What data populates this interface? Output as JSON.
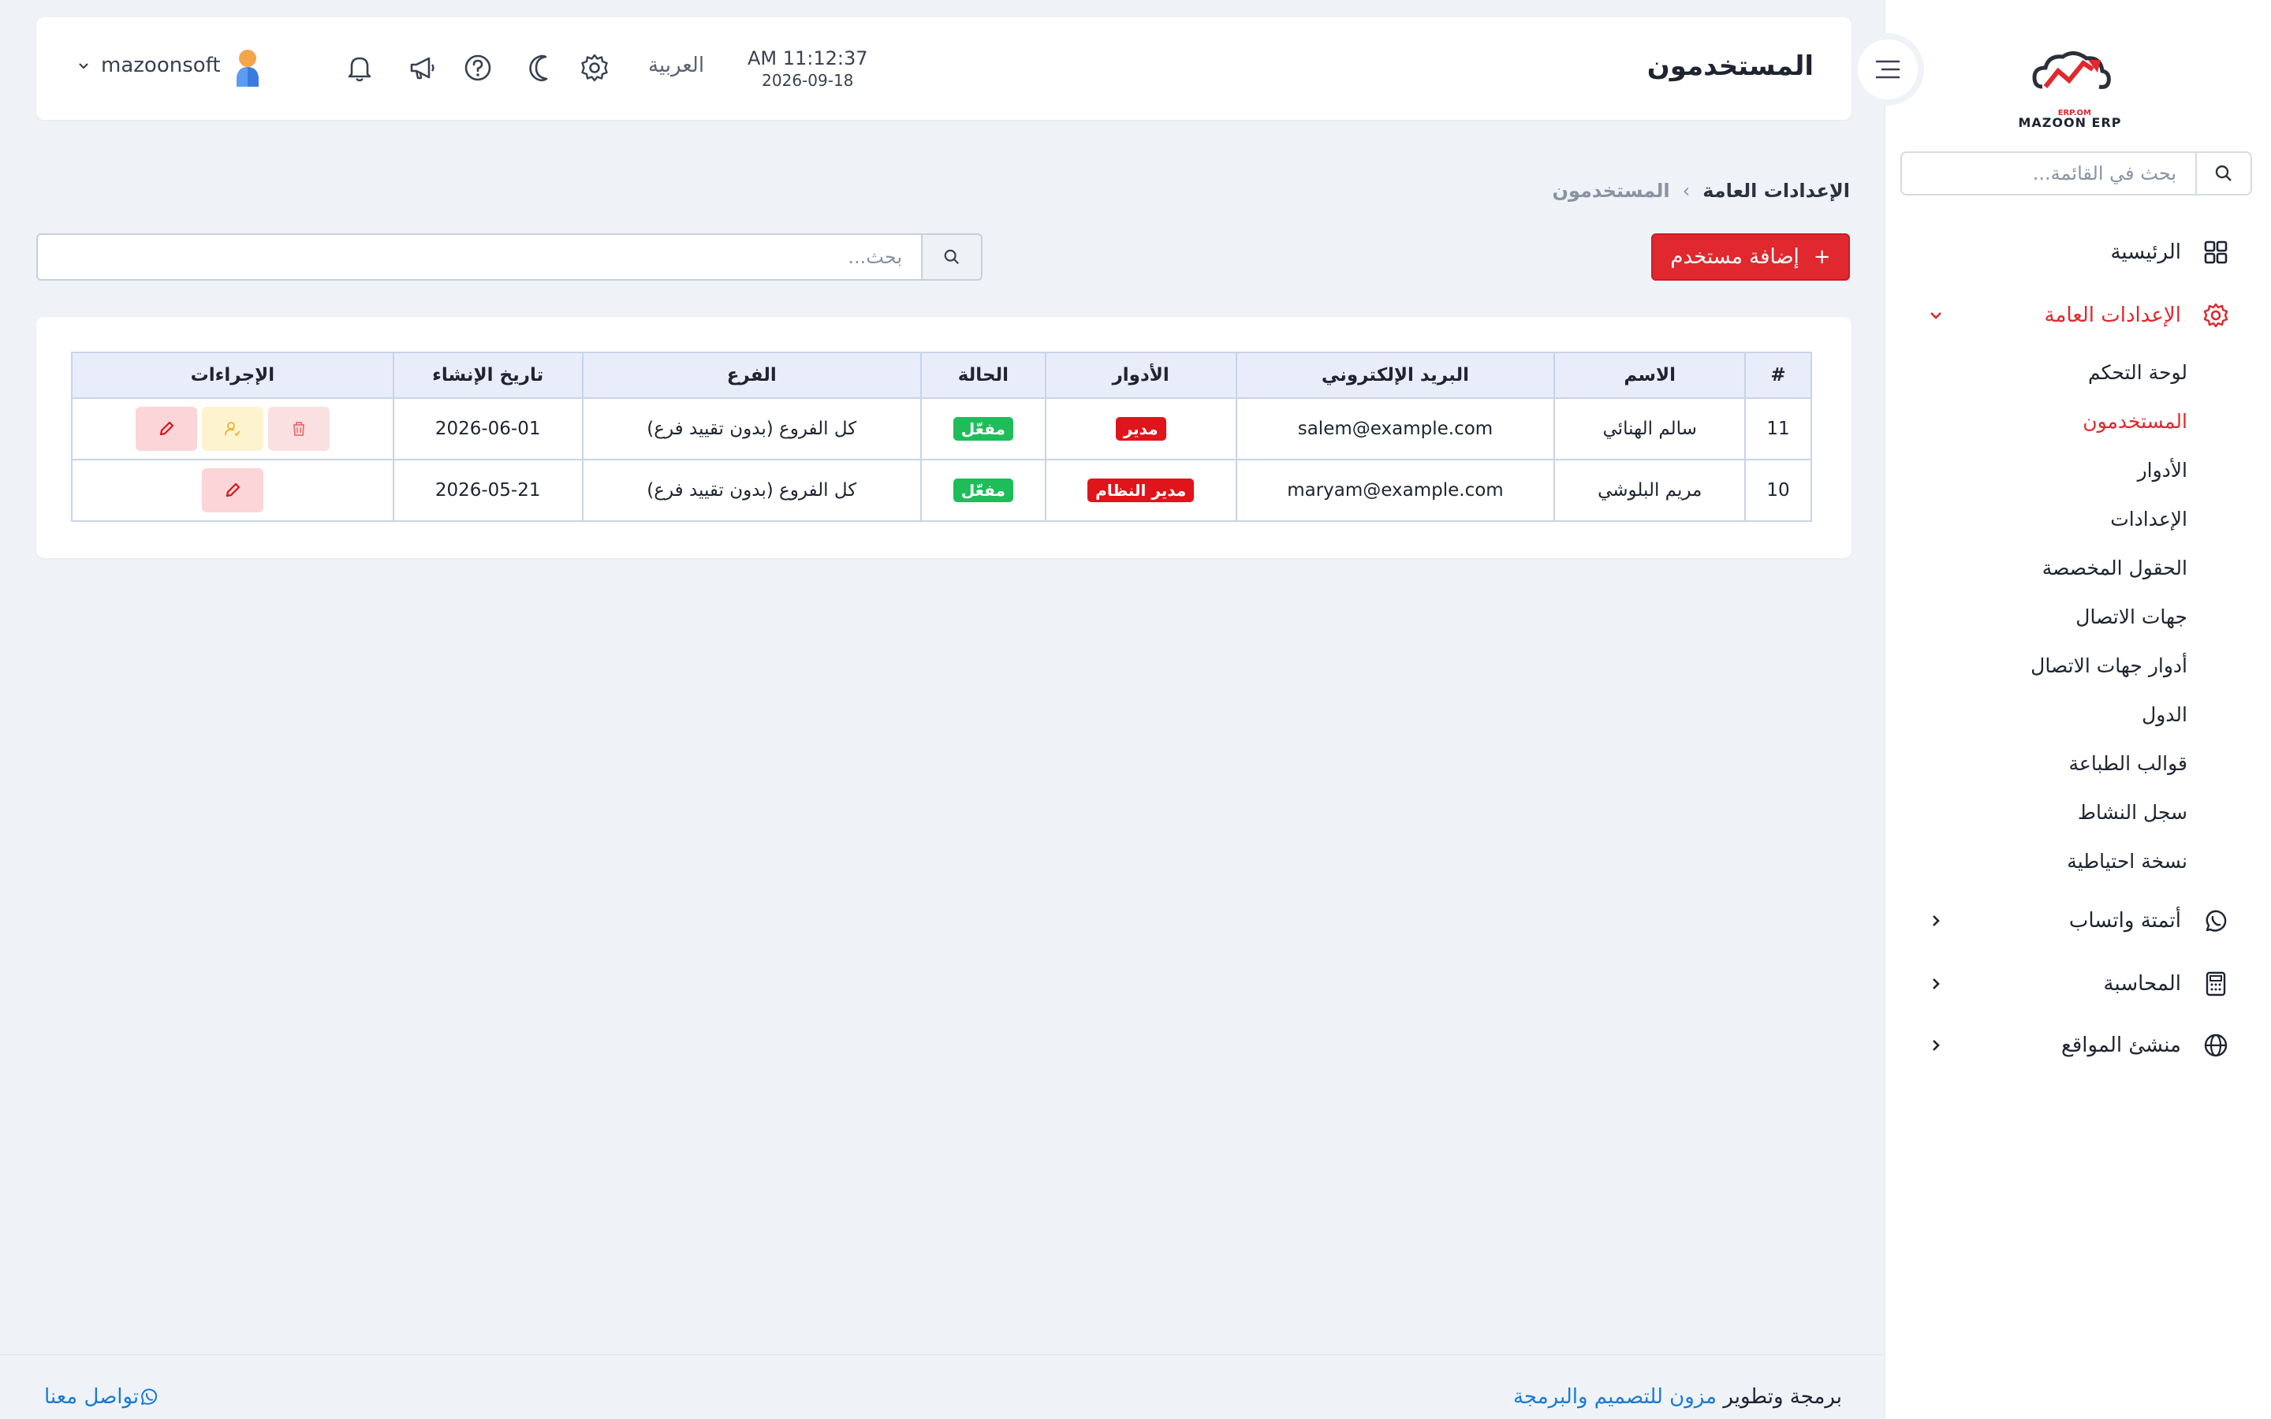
{
  "brand": {
    "name": "MAZOON ERP",
    "sub": "ERP.OM"
  },
  "sidebar": {
    "search_placeholder": "بحث في القائمة...",
    "items": [
      {
        "label": "الرئيسية",
        "icon": "grid-icon"
      },
      {
        "label": "الإعدادات العامة",
        "icon": "gear-icon",
        "active": true,
        "expanded": true
      },
      {
        "label": "أتمتة واتساب",
        "icon": "whatsapp-icon"
      },
      {
        "label": "المحاسبة",
        "icon": "calculator-icon"
      },
      {
        "label": "منشئ المواقع",
        "icon": "globe-icon"
      }
    ],
    "sub_items": [
      {
        "label": "لوحة التحكم"
      },
      {
        "label": "المستخدمون",
        "active": true
      },
      {
        "label": "الأدوار"
      },
      {
        "label": "الإعدادات"
      },
      {
        "label": "الحقول المخصصة"
      },
      {
        "label": "جهات الاتصال"
      },
      {
        "label": "أدوار جهات الاتصال"
      },
      {
        "label": "الدول"
      },
      {
        "label": "قوالب الطباعة"
      },
      {
        "label": "سجل النشاط"
      },
      {
        "label": "نسخة احتياطية"
      }
    ]
  },
  "header": {
    "title": "المستخدمون",
    "time": "AM 11:12:37",
    "date": "2026-09-18",
    "language": "العربية",
    "username": "mazoonsoft"
  },
  "breadcrumb": {
    "parent": "الإعدادات العامة",
    "current": "المستخدمون"
  },
  "toolbar": {
    "add_label": "إضافة مستخدم",
    "search_placeholder": "بحث..."
  },
  "table": {
    "columns": [
      "#",
      "الاسم",
      "البريد الإلكتروني",
      "الأدوار",
      "الحالة",
      "الفرع",
      "تاريخ الإنشاء",
      "الإجراءات"
    ],
    "rows": [
      {
        "id": "11",
        "name": "سالم الهنائي",
        "email": "salem@example.com",
        "role": "مدير",
        "status": "مفعّل",
        "branch": "كل الفروع (بدون تقييد فرع)",
        "created": "2026-06-01"
      },
      {
        "id": "10",
        "name": "مريم البلوشي",
        "email": "maryam@example.com",
        "role": "مدير النظام",
        "status": "مفعّل",
        "branch": "كل الفروع (بدون تقييد فرع)",
        "created": "2026-05-21"
      }
    ]
  },
  "footer": {
    "credit_prefix": "برمجة وتطوير",
    "credit_link": "مزون للتصميم والبرمجة",
    "contact": "تواصل معنا"
  },
  "colors": {
    "accent": "#e0282e",
    "success": "#1ebd5a",
    "link": "#1a7bd6"
  }
}
